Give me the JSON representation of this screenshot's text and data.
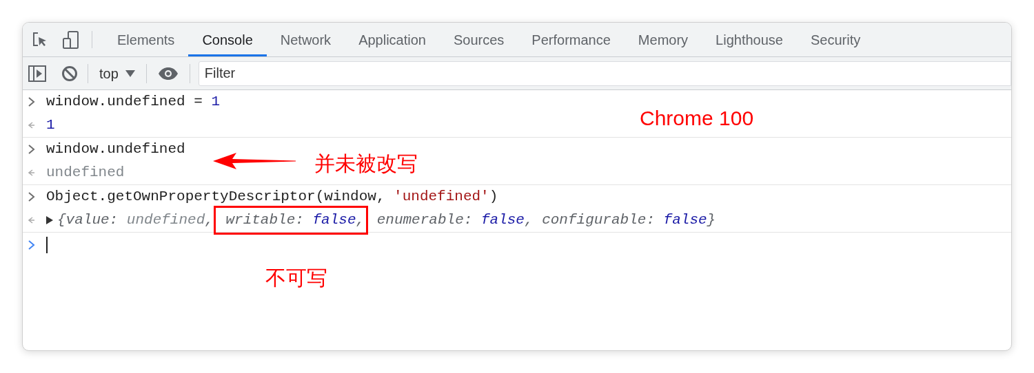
{
  "tabs": [
    {
      "label": "Elements",
      "selected": false
    },
    {
      "label": "Console",
      "selected": true
    },
    {
      "label": "Network",
      "selected": false
    },
    {
      "label": "Application",
      "selected": false
    },
    {
      "label": "Sources",
      "selected": false
    },
    {
      "label": "Performance",
      "selected": false
    },
    {
      "label": "Memory",
      "selected": false
    },
    {
      "label": "Lighthouse",
      "selected": false
    },
    {
      "label": "Security",
      "selected": false
    }
  ],
  "toolbar": {
    "context": "top",
    "filter": {
      "placeholder": "Filter"
    }
  },
  "console": [
    {
      "kind": "input",
      "tokens": [
        {
          "text": "window.undefined = ",
          "kind": "plain"
        },
        {
          "text": "1",
          "kind": "number"
        }
      ]
    },
    {
      "kind": "output",
      "expandable": false,
      "tokens": [
        {
          "text": "1",
          "kind": "number"
        }
      ]
    },
    {
      "kind": "input",
      "tokens": [
        {
          "text": "window.undefined",
          "kind": "plain"
        }
      ]
    },
    {
      "kind": "output",
      "expandable": false,
      "tokens": [
        {
          "text": "undefined",
          "kind": "undefined"
        }
      ]
    },
    {
      "kind": "input",
      "tokens": [
        {
          "text": "Object.getOwnPropertyDescriptor(window, ",
          "kind": "plain"
        },
        {
          "text": "'undefined'",
          "kind": "string"
        },
        {
          "text": ")",
          "kind": "plain"
        }
      ]
    },
    {
      "kind": "output",
      "expandable": true,
      "tokens": [
        {
          "text": "{value: ",
          "kind": "key"
        },
        {
          "text": "undefined",
          "kind": "undefined"
        },
        {
          "text": ",",
          "kind": "key"
        },
        {
          "text": " writable: ",
          "kind": "key",
          "highlighted": true
        },
        {
          "text": "false",
          "kind": "boolean",
          "highlighted": true
        },
        {
          "text": ",",
          "kind": "key",
          "highlighted": true
        },
        {
          "text": " enumerable: ",
          "kind": "key"
        },
        {
          "text": "false",
          "kind": "boolean"
        },
        {
          "text": ", configurable: ",
          "kind": "key"
        },
        {
          "text": "false",
          "kind": "boolean"
        },
        {
          "text": "}",
          "kind": "key"
        }
      ]
    }
  ],
  "annotations": [
    {
      "kind": "label",
      "text": "Chrome 100"
    },
    {
      "kind": "arrow-label",
      "text": "并未被改写"
    },
    {
      "kind": "label-below",
      "text": "不可写"
    }
  ]
}
